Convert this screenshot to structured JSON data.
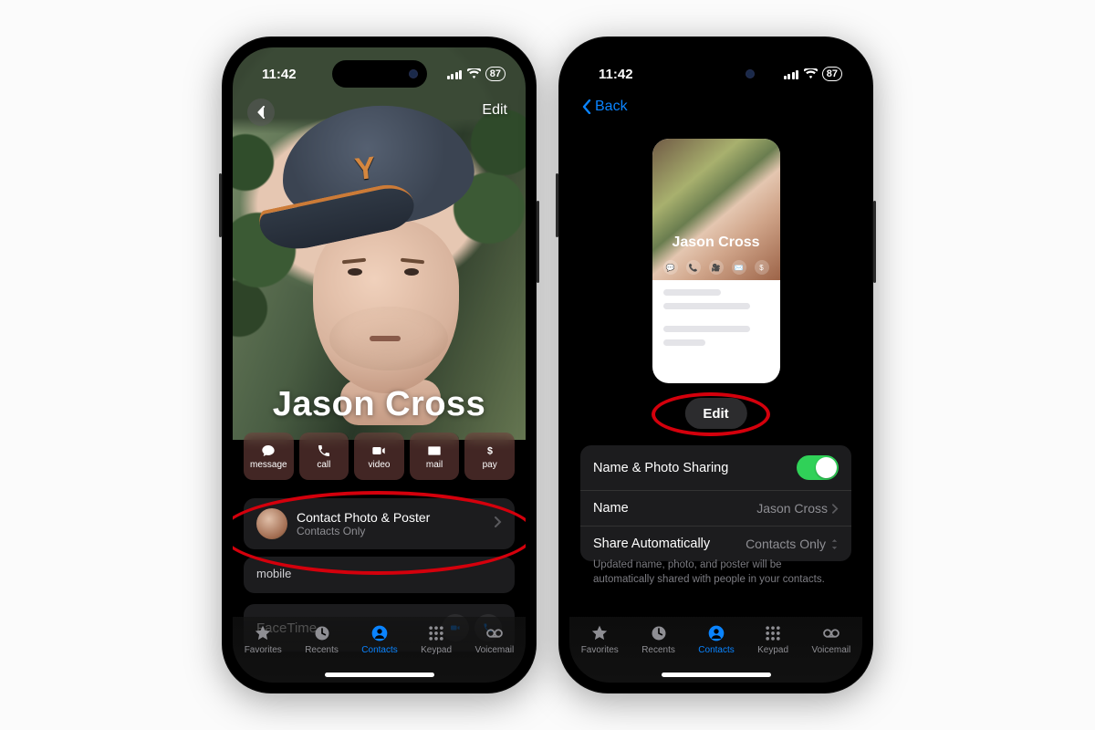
{
  "status": {
    "time": "11:42",
    "battery": "87"
  },
  "phoneA": {
    "editLabel": "Edit",
    "contactName": "Jason Cross",
    "capLogo": "Y",
    "actions": [
      {
        "name": "message-action",
        "label": "message",
        "icon": "bubble"
      },
      {
        "name": "call-action",
        "label": "call",
        "icon": "phone"
      },
      {
        "name": "video-action",
        "label": "video",
        "icon": "video"
      },
      {
        "name": "mail-action",
        "label": "mail",
        "icon": "mail"
      },
      {
        "name": "pay-action",
        "label": "pay",
        "icon": "pay"
      }
    ],
    "posterRow": {
      "title": "Contact Photo & Poster",
      "subtitle": "Contacts Only"
    },
    "mobileLabel": "mobile",
    "facetimeLabel": "FaceTime"
  },
  "phoneB": {
    "backLabel": "Back",
    "previewName": "Jason Cross",
    "editLabel": "Edit",
    "settings": [
      {
        "name": "sharing-toggle-row",
        "label": "Name & Photo Sharing",
        "type": "toggle",
        "on": true
      },
      {
        "name": "name-row",
        "label": "Name",
        "type": "link",
        "value": "Jason Cross"
      },
      {
        "name": "share-auto-row",
        "label": "Share Automatically",
        "type": "select",
        "value": "Contacts Only"
      }
    ],
    "footnote": "Updated name, photo, and poster will be automatically shared with people in your contacts."
  },
  "tabs": [
    {
      "name": "tab-favorites",
      "label": "Favorites",
      "icon": "star"
    },
    {
      "name": "tab-recents",
      "label": "Recents",
      "icon": "clock"
    },
    {
      "name": "tab-contacts",
      "label": "Contacts",
      "icon": "person",
      "active": true
    },
    {
      "name": "tab-keypad",
      "label": "Keypad",
      "icon": "grid"
    },
    {
      "name": "tab-voicemail",
      "label": "Voicemail",
      "icon": "voicemail"
    }
  ]
}
